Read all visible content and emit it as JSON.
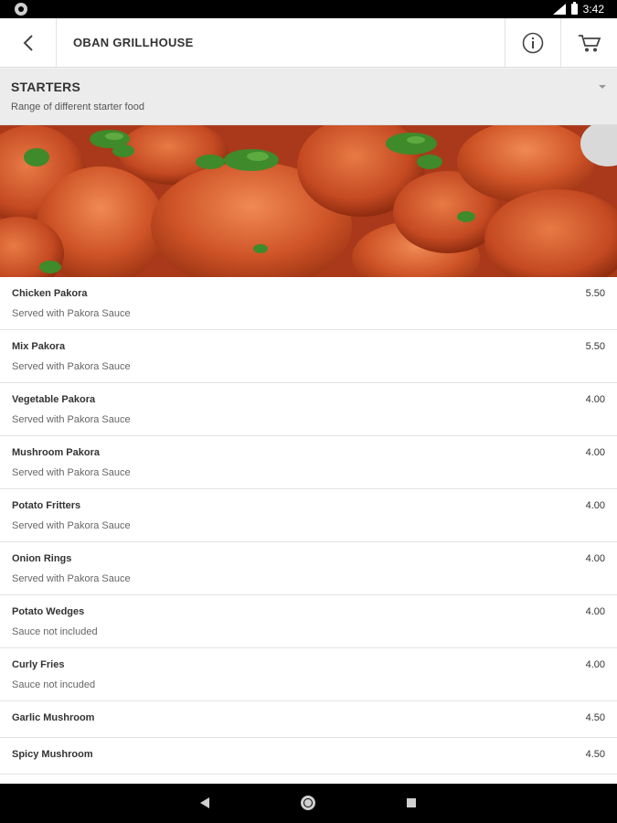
{
  "status_bar": {
    "time": "3:42"
  },
  "header": {
    "title": "OBAN GRILLHOUSE",
    "icons": [
      "back-icon",
      "info-icon",
      "cart-icon"
    ]
  },
  "category": {
    "title": "STARTERS",
    "description": "Range of different starter food"
  },
  "menu_items": [
    {
      "name": "Chicken Pakora",
      "description": "Served with Pakora Sauce",
      "price": "5.50"
    },
    {
      "name": "Mix Pakora",
      "description": "Served with Pakora Sauce",
      "price": "5.50"
    },
    {
      "name": "Vegetable Pakora",
      "description": "Served with Pakora Sauce",
      "price": "4.00"
    },
    {
      "name": "Mushroom Pakora",
      "description": "Served with Pakora Sauce",
      "price": "4.00"
    },
    {
      "name": "Potato Fritters",
      "description": "Served with Pakora Sauce",
      "price": "4.00"
    },
    {
      "name": "Onion Rings",
      "description": "Served with Pakora Sauce",
      "price": "4.00"
    },
    {
      "name": "Potato Wedges",
      "description": "Sauce not included",
      "price": "4.00"
    },
    {
      "name": "Curly Fries",
      "description": "Sauce not incuded",
      "price": "4.00"
    },
    {
      "name": "Garlic Mushroom",
      "description": "",
      "price": "4.50"
    },
    {
      "name": "Spicy Mushroom",
      "description": "",
      "price": "4.50"
    }
  ],
  "colors": {
    "status_bar": "#000000",
    "category_bg": "#ececec",
    "banner_food": "#c8532b",
    "garnish": "#3f8a2a"
  }
}
